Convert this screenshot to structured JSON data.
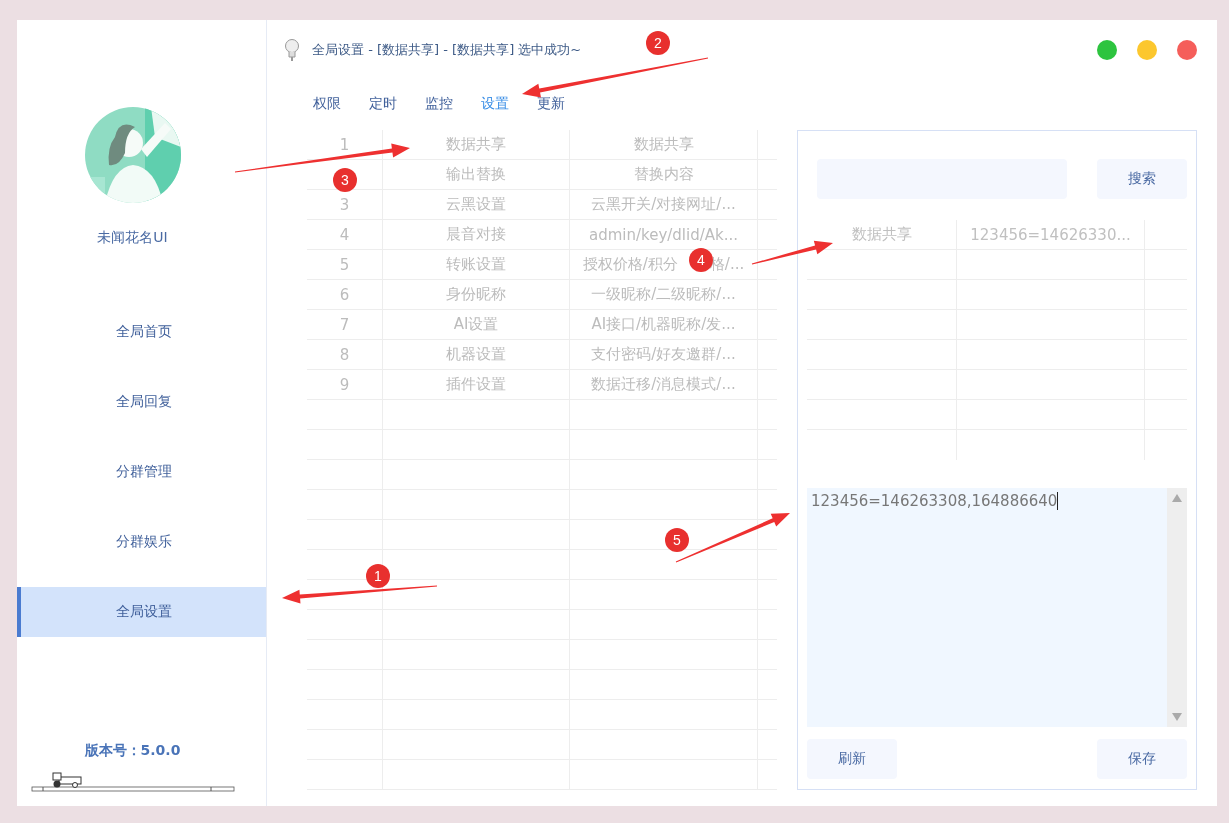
{
  "window": {
    "title": "全局设置 - [数据共享] - [数据共享] 选中成功~"
  },
  "sidebar": {
    "user_name": "未闻花名UI",
    "items": [
      {
        "label": "全局首页",
        "selected": false
      },
      {
        "label": "全局回复",
        "selected": false
      },
      {
        "label": "分群管理",
        "selected": false
      },
      {
        "label": "分群娱乐",
        "selected": false
      },
      {
        "label": "全局设置",
        "selected": true
      }
    ],
    "version": "版本号：5.0.0"
  },
  "tabs": [
    {
      "label": "权限",
      "selected": false
    },
    {
      "label": "定时",
      "selected": false
    },
    {
      "label": "监控",
      "selected": false
    },
    {
      "label": "设置",
      "selected": true
    },
    {
      "label": "更新",
      "selected": false
    }
  ],
  "table": {
    "rows": [
      {
        "number": "1",
        "name": "数据共享",
        "content": "数据共享"
      },
      {
        "name": "输出替换",
        "content": "替换内容"
      },
      {
        "number": "3",
        "name": "云黑设置",
        "content": "云黑开关/对接网址/..."
      },
      {
        "number": "4",
        "name": "晨音对接",
        "content": "admin/key/dlid/Ak..."
      },
      {
        "number": "5",
        "name": "转账设置",
        "content": [
          "授权价格/积分",
          "格/..."
        ]
      },
      {
        "number": "6",
        "name": "身份昵称",
        "content": "一级昵称/二级昵称/..."
      },
      {
        "number": "7",
        "name": "AI设置",
        "content": "AI接口/机器昵称/发..."
      },
      {
        "number": "8",
        "name": "机器设置",
        "content": "支付密码/好友邀群/..."
      },
      {
        "number": "9",
        "name": "插件设置",
        "content": "数据迁移/消息模式/..."
      }
    ]
  },
  "panel": {
    "search_button": "搜索",
    "results": [
      {
        "name": "数据共享",
        "value": "123456=14626330..."
      }
    ],
    "editor": {
      "value": "123456=146263308,164886640"
    },
    "buttons": [
      "刷新",
      "保存"
    ]
  },
  "annotations": [
    {
      "label": "1"
    },
    {
      "label": "2"
    },
    {
      "label": "3"
    },
    {
      "label": "4"
    },
    {
      "label": "5"
    }
  ]
}
